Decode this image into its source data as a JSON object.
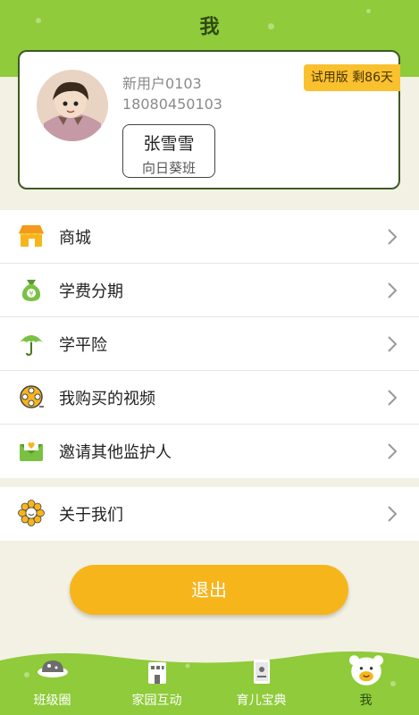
{
  "header": {
    "title": "我"
  },
  "profile": {
    "name": "新用户0103",
    "phone": "18080450103",
    "child_name": "张雪雪",
    "child_class": "向日葵班",
    "trial_badge": "试用版 剩86天"
  },
  "menu": {
    "items": [
      {
        "label": "商城",
        "icon": "store-icon"
      },
      {
        "label": "学费分期",
        "icon": "money-bag-icon"
      },
      {
        "label": "学平险",
        "icon": "umbrella-icon"
      },
      {
        "label": "我购买的视频",
        "icon": "film-reel-icon"
      },
      {
        "label": "邀请其他监护人",
        "icon": "invite-envelope-icon"
      }
    ],
    "about": {
      "label": "关于我们",
      "icon": "sunflower-icon"
    }
  },
  "logout_label": "退出",
  "tabs": [
    {
      "label": "班级圈",
      "icon": "planet-icon"
    },
    {
      "label": "家园互动",
      "icon": "building-icon"
    },
    {
      "label": "育儿宝典",
      "icon": "book-icon"
    },
    {
      "label": "我",
      "icon": "bear-face-icon",
      "active": true
    }
  ],
  "colors": {
    "brand_green": "#8fcb3a",
    "accent_yellow": "#f7b51c",
    "background": "#f3f1e4"
  }
}
